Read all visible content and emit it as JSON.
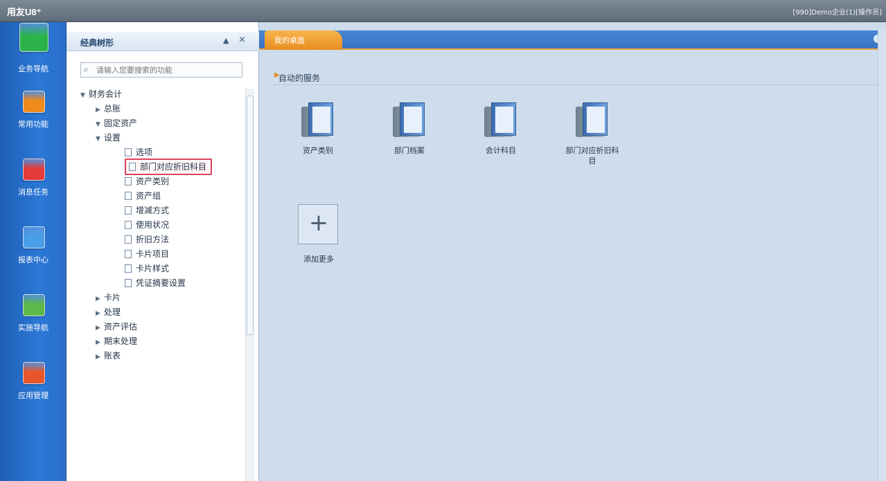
{
  "window": {
    "title": "用友U8⁺",
    "user_info": "[990]Demo企业(1)[操作员]"
  },
  "left_nav": {
    "items": [
      {
        "label": "业务导航",
        "icon": "grid-icon",
        "color": "#2bb34a"
      },
      {
        "label": "常用功能",
        "icon": "star-icon",
        "color": "#f08a1c"
      },
      {
        "label": "消息任务",
        "icon": "checklist-icon",
        "color": "#e53b3b"
      },
      {
        "label": "报表中心",
        "icon": "chart-icon",
        "color": "#4a9ee8"
      },
      {
        "label": "实施导航",
        "icon": "compass-icon",
        "color": "#5fb84a"
      },
      {
        "label": "应用管理",
        "icon": "apps-icon",
        "color": "#e8562a"
      }
    ]
  },
  "tree_panel": {
    "title": "经典树形",
    "search_placeholder": "请输入您要搜索的功能",
    "nodes": [
      {
        "label": "财务会计",
        "level": 0,
        "expanded": true
      },
      {
        "label": "总账",
        "level": 1,
        "expanded": false
      },
      {
        "label": "固定资产",
        "level": 1,
        "expanded": true
      },
      {
        "label": "设置",
        "level": 2,
        "expanded": true
      },
      {
        "label": "选项",
        "level": 3,
        "leaf": true
      },
      {
        "label": "部门对应折旧科目",
        "level": 3,
        "leaf": true,
        "selected": true
      },
      {
        "label": "资产类别",
        "level": 3,
        "leaf": true
      },
      {
        "label": "资产组",
        "level": 3,
        "leaf": true
      },
      {
        "label": "增减方式",
        "level": 3,
        "leaf": true
      },
      {
        "label": "使用状况",
        "level": 3,
        "leaf": true
      },
      {
        "label": "折旧方法",
        "level": 3,
        "leaf": true
      },
      {
        "label": "卡片项目",
        "level": 3,
        "leaf": true
      },
      {
        "label": "卡片样式",
        "level": 3,
        "leaf": true
      },
      {
        "label": "凭证摘要设置",
        "level": 3,
        "leaf": true
      },
      {
        "label": "卡片",
        "level": 2,
        "expanded": false
      },
      {
        "label": "处理",
        "level": 2,
        "expanded": false
      },
      {
        "label": "资产评估",
        "level": 2,
        "expanded": false
      },
      {
        "label": "期末处理",
        "level": 2,
        "expanded": false
      },
      {
        "label": "账表",
        "level": 2,
        "expanded": false
      }
    ]
  },
  "main": {
    "tab_label": "我的桌面",
    "section_title": "自动的服务",
    "shortcuts": [
      {
        "label": "资产类别"
      },
      {
        "label": "部门档案"
      },
      {
        "label": "会计科目"
      },
      {
        "label": "部门对应折旧科目"
      }
    ],
    "add_more_label": "添加更多",
    "add_symbol": "+"
  }
}
